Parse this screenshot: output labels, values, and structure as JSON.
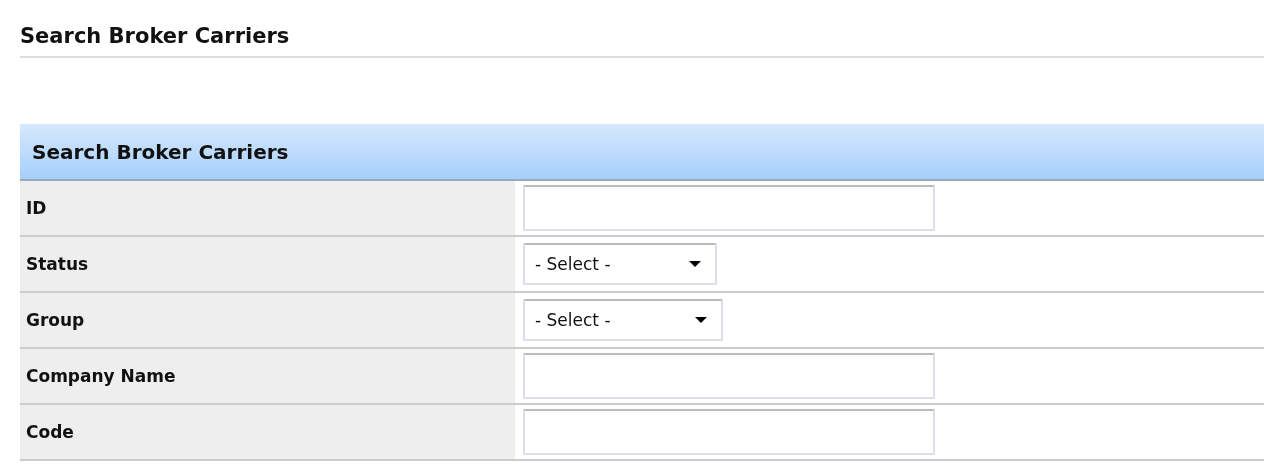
{
  "page_title": "Search Broker Carriers",
  "panel": {
    "title": "Search Broker Carriers",
    "fields": [
      {
        "label": "ID",
        "kind": "text"
      },
      {
        "label": "Status",
        "kind": "select",
        "value": "- Select -"
      },
      {
        "label": "Group",
        "kind": "select",
        "value": "- Select -"
      },
      {
        "label": "Company Name",
        "kind": "text"
      },
      {
        "label": "Code",
        "kind": "text"
      }
    ]
  }
}
